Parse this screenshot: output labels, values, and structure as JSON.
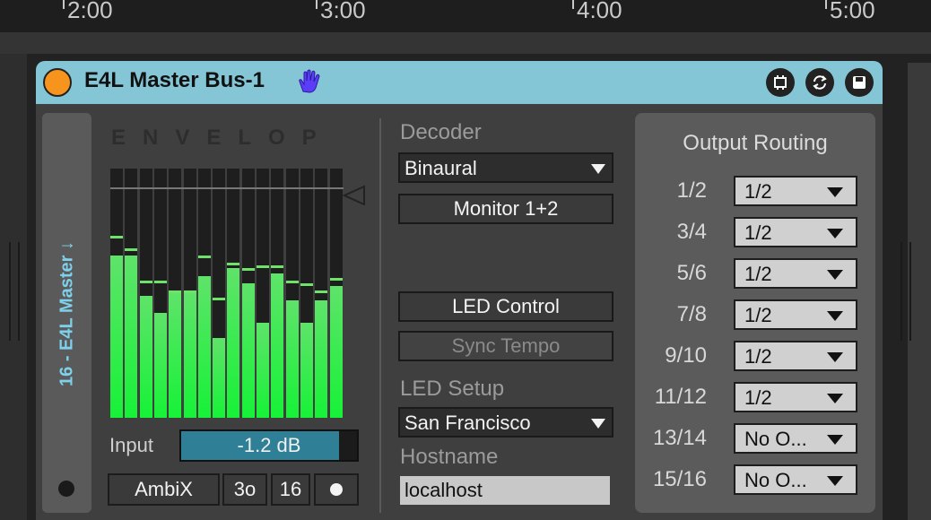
{
  "timeline": {
    "ticks": [
      "2:00",
      "3:00",
      "4:00",
      "5:00"
    ]
  },
  "device": {
    "title": "E4L Master Bus-1",
    "track_label": "16 - E4L Master ↓",
    "logo": "ENVELOP",
    "meters": {
      "levels": [
        0.65,
        0.65,
        0.49,
        0.42,
        0.5,
        0.5,
        0.57,
        0.32,
        0.6,
        0.54,
        0.38,
        0.58,
        0.47,
        0.38,
        0.47,
        0.53
      ],
      "peaks": [
        0.72,
        0.67,
        0.54,
        0.54,
        0.5,
        0.5,
        0.64,
        0.47,
        0.61,
        0.59,
        0.6,
        0.6,
        0.54,
        0.53,
        0.5,
        0.55
      ]
    },
    "input": {
      "label": "Input",
      "value": "-1.2 dB",
      "level": 0.9
    },
    "format_buttons": {
      "ambix": "AmbiX",
      "order": "3o",
      "channels": "16"
    },
    "decoder": {
      "label": "Decoder",
      "value": "Binaural",
      "monitor": "Monitor 1+2"
    },
    "led": {
      "control": "LED Control",
      "sync": "Sync Tempo",
      "setup_label": "LED Setup",
      "setup_value": "San Francisco",
      "hostname_label": "Hostname",
      "hostname_value": "localhost"
    },
    "routing": {
      "title": "Output Routing",
      "rows": [
        {
          "label": "1/2",
          "value": "1/2"
        },
        {
          "label": "3/4",
          "value": "1/2"
        },
        {
          "label": "5/6",
          "value": "1/2"
        },
        {
          "label": "7/8",
          "value": "1/2"
        },
        {
          "label": "9/10",
          "value": "1/2"
        },
        {
          "label": "11/12",
          "value": "1/2"
        },
        {
          "label": "13/14",
          "value": "No O..."
        },
        {
          "label": "15/16",
          "value": "No O..."
        }
      ]
    },
    "colors": {
      "titlebar": "#84c6d6",
      "power": "#f7941d",
      "meter_green": "#16f237",
      "track_label": "#7fd0ea"
    }
  }
}
